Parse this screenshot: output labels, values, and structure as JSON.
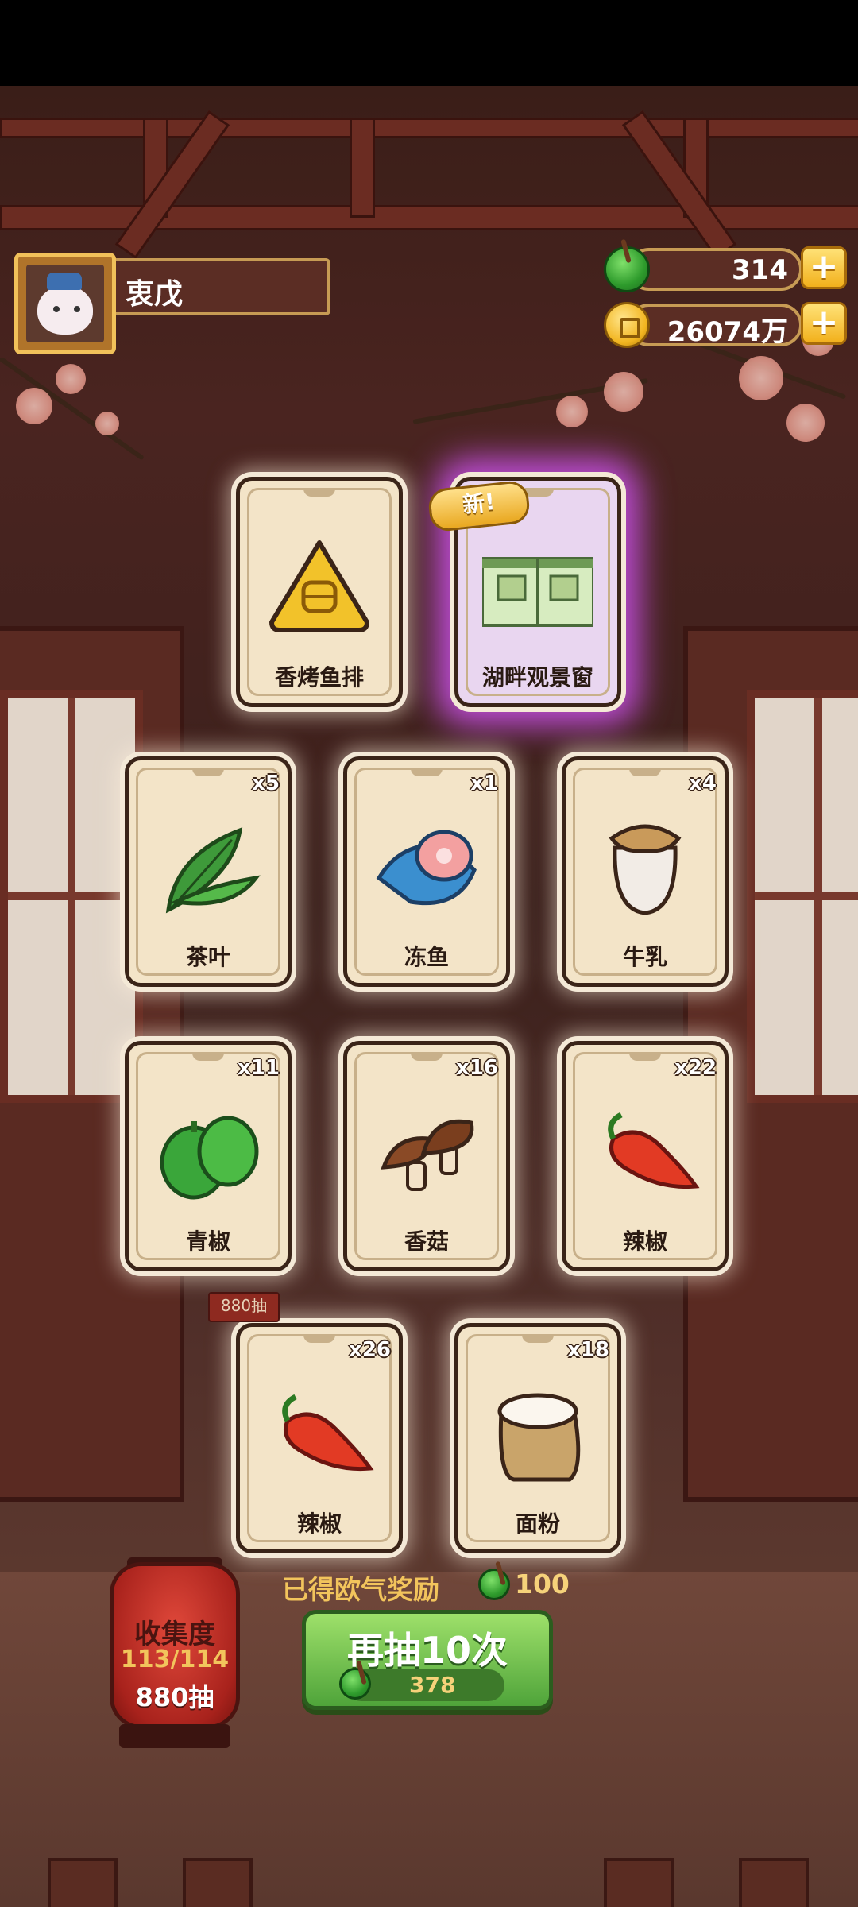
{
  "player": {
    "name": "衷戊"
  },
  "currency": {
    "jade": "314",
    "gold": "26074万"
  },
  "banner": {
    "new_tag": "新!"
  },
  "cards": [
    {
      "label": "香烤鱼排",
      "count": "",
      "icon": "fish-cake-icon"
    },
    {
      "label": "湖畔观景窗",
      "count": "",
      "icon": "lakeside-window-icon"
    },
    {
      "label": "茶叶",
      "count": "x5",
      "icon": "tea-leaf-icon"
    },
    {
      "label": "冻鱼",
      "count": "x1",
      "icon": "frozen-fish-icon"
    },
    {
      "label": "牛乳",
      "count": "x4",
      "icon": "milk-jar-icon"
    },
    {
      "label": "青椒",
      "count": "x11",
      "icon": "green-pepper-icon"
    },
    {
      "label": "香菇",
      "count": "x16",
      "icon": "mushroom-icon"
    },
    {
      "label": "辣椒",
      "count": "x22",
      "icon": "chili-icon"
    },
    {
      "label": "辣椒",
      "count": "x26",
      "icon": "chili-icon"
    },
    {
      "label": "面粉",
      "count": "x18",
      "icon": "flour-sack-icon"
    }
  ],
  "reward": {
    "text": "已得欧气奖励",
    "amount": "100"
  },
  "redraw": {
    "label": "再抽10次",
    "cost": "378"
  },
  "collection": {
    "title": "收集度",
    "progress": "113/114",
    "draws": "880抽",
    "small_tag": "880抽"
  },
  "colors": {
    "jade": "#2e9b2c",
    "gold": "#f2b520",
    "button_green": "#4fa43a",
    "lantern_red": "#a8221c",
    "special_glow": "#c850e6"
  }
}
